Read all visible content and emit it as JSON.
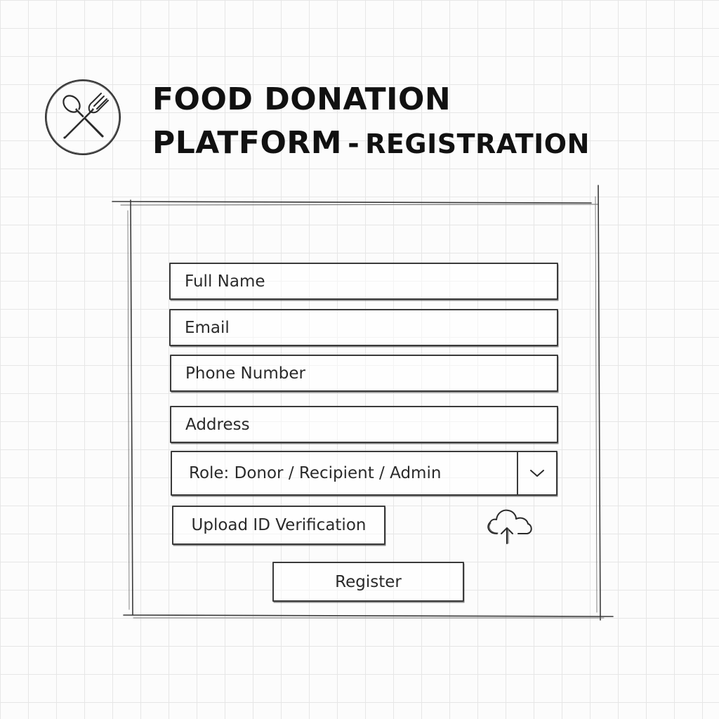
{
  "header": {
    "logo_icon": "spoon-fork-icon",
    "title_line1": "FOOD DONATION",
    "title_line2": "PLATFORM",
    "title_separator": "-",
    "title_subtitle": "REGISTRATION"
  },
  "form": {
    "full_name": "Full Name",
    "email": "Email",
    "phone": "Phone Number",
    "address": "Address",
    "role_select": {
      "value": "Role: Donor / Recipient / Admin",
      "icon": "chevron-down-icon"
    },
    "upload_label": "Upload ID Verification",
    "upload_icon": "cloud-upload-icon",
    "register_label": "Register"
  }
}
